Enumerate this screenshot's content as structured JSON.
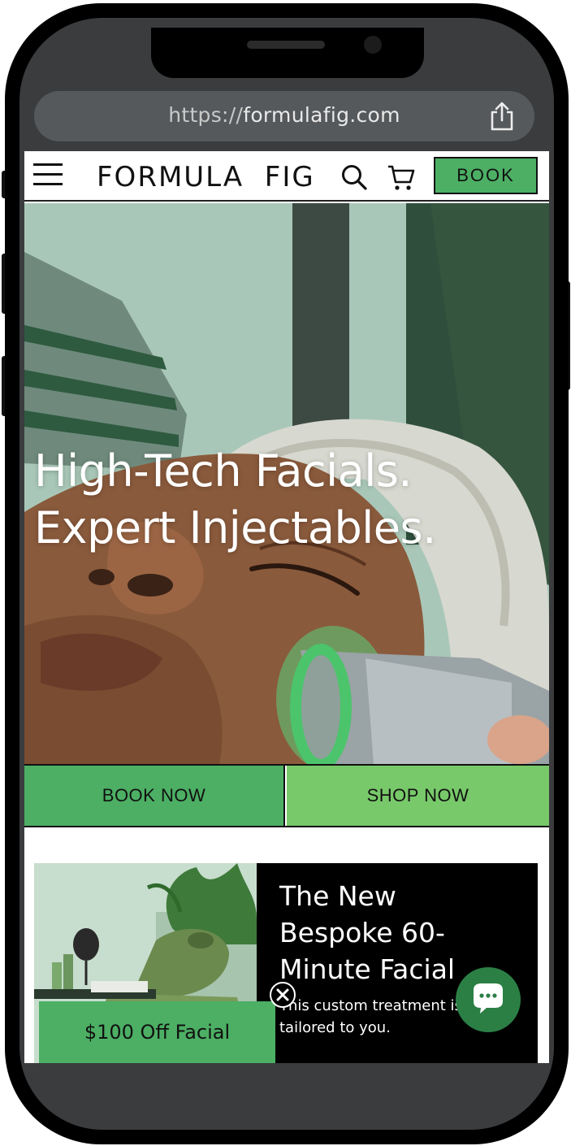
{
  "browser": {
    "url_prefix": "https://",
    "url_domain": "formulafig.com",
    "share_icon": "share-icon"
  },
  "navbar": {
    "menu_icon": "hamburger-menu-icon",
    "logo": "FORMULA  FIG",
    "search_icon": "search-icon",
    "cart_icon": "cart-icon",
    "book_label": "BOOK"
  },
  "hero": {
    "headline_line1": "High-Tech Facials.",
    "headline_line2": "Expert Injectables."
  },
  "cta": {
    "book_now": "BOOK NOW",
    "shop_now": "SHOP NOW"
  },
  "feature": {
    "title_line1": "The New",
    "title_line2": "Bespoke 60-",
    "title_line3": "Minute Facial",
    "desc_line1": "This custom treatment is",
    "desc_line2": "tailored to you."
  },
  "promo": {
    "label": "$100 Off Facial",
    "close_icon": "close-circle-icon"
  },
  "chat": {
    "icon": "chat-bubble-icon"
  },
  "colors": {
    "brand_green": "#4caf64",
    "light_green": "#78c96a",
    "chat_green": "#2b7f45",
    "url_bar": "#56595c"
  }
}
